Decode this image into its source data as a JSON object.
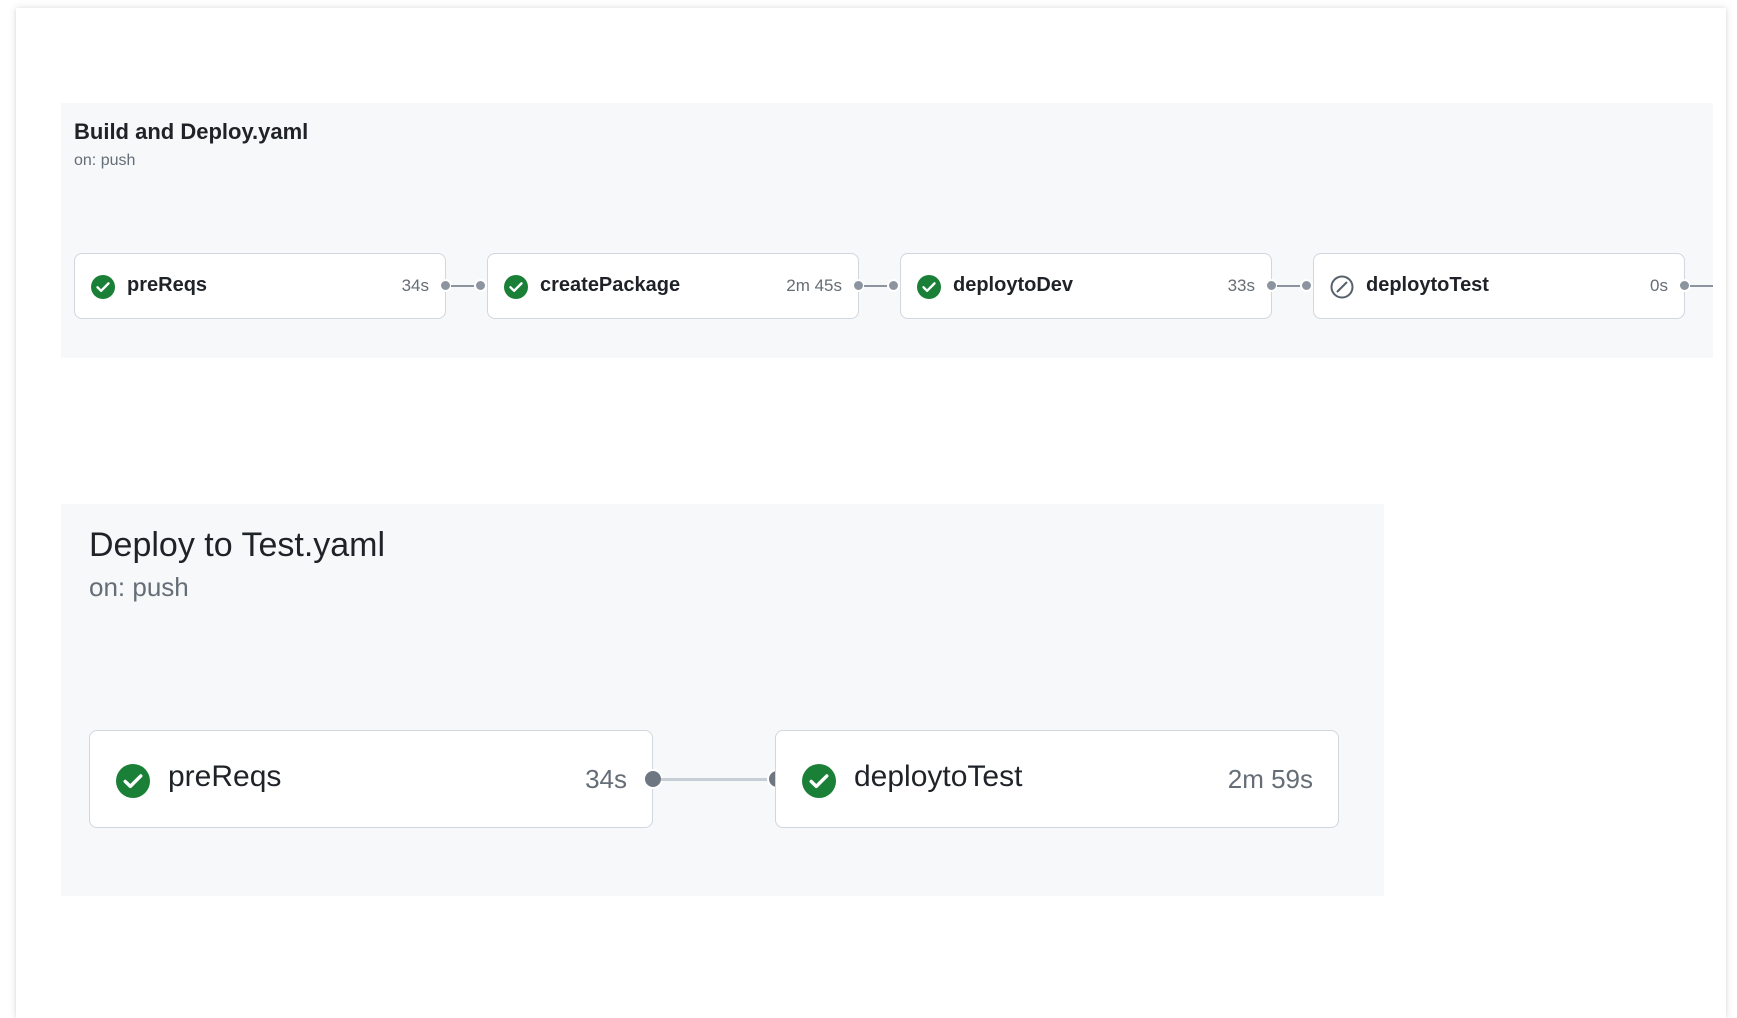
{
  "workflows": [
    {
      "title": "Build and Deploy.yaml",
      "trigger": "on: push",
      "jobs": [
        {
          "name": "preReqs",
          "duration": "34s",
          "status": "success"
        },
        {
          "name": "createPackage",
          "duration": "2m 45s",
          "status": "success"
        },
        {
          "name": "deploytoDev",
          "duration": "33s",
          "status": "success"
        },
        {
          "name": "deploytoTest",
          "duration": "0s",
          "status": "skipped"
        }
      ]
    },
    {
      "title": "Deploy to Test.yaml",
      "trigger": "on: push",
      "jobs": [
        {
          "name": "preReqs",
          "duration": "34s",
          "status": "success"
        },
        {
          "name": "deploytoTest",
          "duration": "2m 59s",
          "status": "success"
        }
      ]
    }
  ],
  "colors": {
    "success": "#1a7f37",
    "skipped": "#57606a",
    "panel_bg": "#f6f8fa",
    "border": "#d0d7de"
  },
  "icons": {
    "success": "check-circle-fill-icon",
    "skipped": "skip-icon"
  }
}
